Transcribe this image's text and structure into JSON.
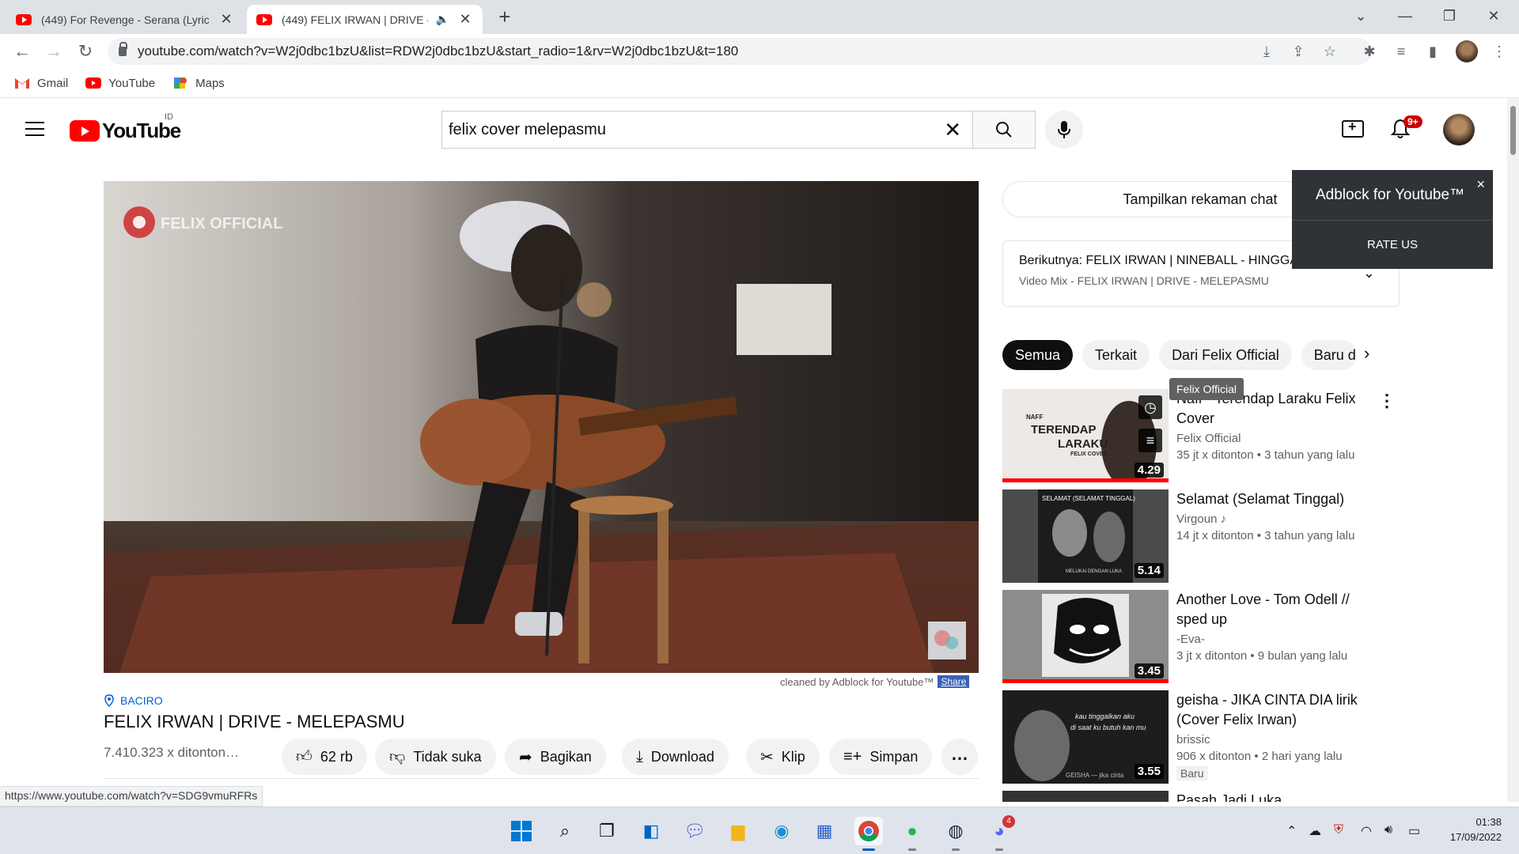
{
  "browser": {
    "tabs": [
      {
        "title": "(449) For Revenge - Serana (Lyric",
        "active": false
      },
      {
        "title": "(449) FELIX IRWAN | DRIVE -",
        "active": true
      }
    ],
    "new_tab": "+",
    "url": "youtube.com/watch?v=W2j0dbc1bzU&list=RDW2j0dbc1bzU&start_radio=1&rv=W2j0dbc1bzU&t=180",
    "bookmarks": [
      {
        "label": "Gmail",
        "icon": "gmail-icon"
      },
      {
        "label": "YouTube",
        "icon": "youtube-icon"
      },
      {
        "label": "Maps",
        "icon": "maps-icon"
      }
    ],
    "status_url": "https://www.youtube.com/watch?v=SDG9vmuRFRs"
  },
  "youtube": {
    "logo_word": "YouTube",
    "country_code": "ID",
    "search_value": "felix cover melepasmu",
    "notification_count": "9+",
    "player": {
      "watermark": "FELIX OFFICIAL",
      "adblock_line": "cleaned by Adblock for Youtube™",
      "share_label": "Share"
    },
    "video": {
      "location": "BACIRO",
      "title": "FELIX IRWAN | DRIVE - MELEPASMU",
      "views": "7.410.323 x ditonton…",
      "likes": "62 rb",
      "dislike_label": "Tidak suka",
      "share_label": "Bagikan",
      "download_label": "Download",
      "clip_label": "Klip",
      "save_label": "Simpan",
      "more_label": "…"
    },
    "sidebar": {
      "chat_button": "Tampilkan rekaman chat",
      "next_prefix": "Berikutnya:",
      "next_title": "FELIX IRWAN | NINEBALL - HINGGA AK…",
      "next_sub": "Video Mix - FELIX IRWAN | DRIVE - MELEPASMU",
      "chips": [
        "Semua",
        "Terkait",
        "Dari Felix Official",
        "Baru d"
      ],
      "tooltip": "Felix Official",
      "recommendations": [
        {
          "title": "Naff - Terendap Laraku Felix Cover",
          "channel": "Felix Official",
          "stats": "35 jt x ditonton • 3 tahun yang lalu",
          "duration": "4.29",
          "thumb_text_1": "NAFF",
          "thumb_text_2": "TERENDAP",
          "thumb_text_3": "LARAKU",
          "thumb_text_4": "FELIX COVER",
          "watched": 1.0
        },
        {
          "title": "Selamat (Selamat Tinggal)",
          "channel": "Virgoun",
          "stats": "14 jt x ditonton • 3 tahun yang lalu",
          "duration": "5.14",
          "thumb_text_1": "SELAMAT (SELAMAT TINGGAL)",
          "thumb_text_2": "MELUKAI DENGAN LUKA",
          "watched": 0
        },
        {
          "title": "Another Love - Tom Odell // sped up",
          "channel": "-Eva-",
          "stats": "3 jt x ditonton • 9 bulan yang lalu",
          "duration": "3.45",
          "watched": 1.0
        },
        {
          "title": "geisha - JIKA CINTA DIA lirik (Cover Felix Irwan)",
          "channel": "brissic",
          "stats": "906 x ditonton • 2 hari yang lalu",
          "duration": "3.55",
          "badge": "Baru",
          "thumb_text_1": "kau tinggalkan aku",
          "thumb_text_2": "di saat ku butuh kan mu",
          "thumb_text_3": "GEISHA — jika cinta",
          "watched": 0
        },
        {
          "title": "Pasah Jadi Luka",
          "watched": 0
        }
      ]
    },
    "adblock_popup": {
      "title": "Adblock for Youtube™",
      "close": "×",
      "rate_label": "RATE US"
    }
  },
  "taskbar": {
    "discord_badge": "4",
    "time": "01:38",
    "date": "17/09/2022"
  }
}
